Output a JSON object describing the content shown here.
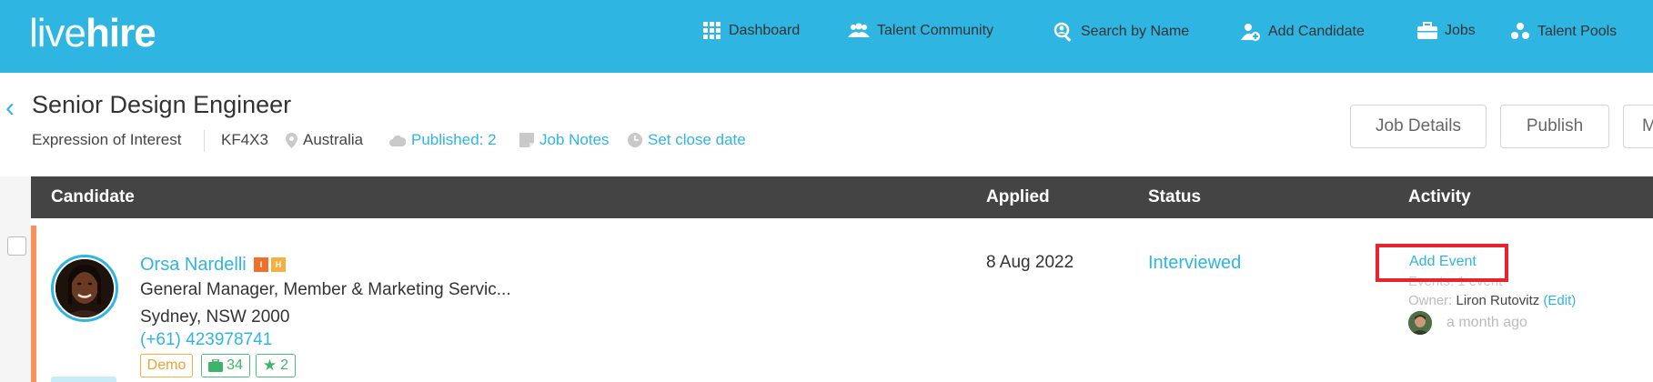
{
  "brand": {
    "logo_light": "live",
    "logo_bold": "hire"
  },
  "nav": {
    "dashboard": "Dashboard",
    "talent_community": "Talent Community",
    "search_by_name": "Search by Name",
    "add_candidate": "Add Candidate",
    "jobs": "Jobs",
    "talent_pools": "Talent Pools"
  },
  "job": {
    "title": "Senior Design Engineer",
    "type": "Expression of Interest",
    "code": "KF4X3",
    "location": "Australia",
    "published": "Published: 2",
    "job_notes": "Job Notes",
    "close_date": "Set close date"
  },
  "actions": {
    "job_details": "Job Details",
    "publish": "Publish",
    "more": "M"
  },
  "table": {
    "headers": {
      "candidate": "Candidate",
      "applied": "Applied",
      "status": "Status",
      "activity": "Activity"
    }
  },
  "candidate": {
    "name": "Orsa Nardelli",
    "badge_i": "I",
    "badge_h": "H",
    "role": "General Manager, Member & Marketing Servic...",
    "location": "Sydney, NSW 2000",
    "phone": "(+61) 423978741",
    "tag_demo": "Demo",
    "tag_jobs": "34",
    "tag_stars": "2",
    "applied": "8 Aug 2022",
    "status": "Interviewed",
    "add_event": "Add Event",
    "events": "Events: 1 event",
    "owner_label": "Owner:",
    "owner_name": "Liron Rutovitz",
    "owner_edit": "(Edit)",
    "last_activity": "a month ago"
  },
  "colors": {
    "brand": "#2fb5e2",
    "header_dark": "#444444",
    "accent_orange": "#f6915a",
    "highlight_red": "#e8232d"
  }
}
